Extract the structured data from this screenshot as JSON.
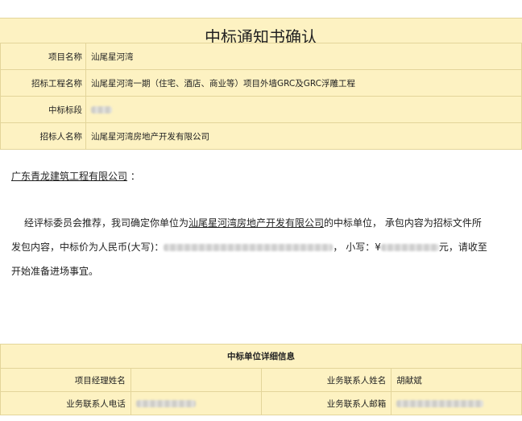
{
  "title": "中标通知书确认",
  "info": {
    "project_name_label": "项目名称",
    "project_name": "汕尾星河湾",
    "tender_project_label": "招标工程名称",
    "tender_project": "汕尾星河湾一期（住宅、酒店、商业等）项目外墙GRC及GRC浮雕工程",
    "winning_section_label": "中标标段",
    "tenderer_label": "招标人名称",
    "tenderer": "汕尾星河湾房地产开发有限公司"
  },
  "letter": {
    "addressee": "广东青龙建筑工程有限公司",
    "addressee_suffix": "：",
    "line1_a": "经评标委员会推荐，我司确定你单位为",
    "line1_company": "汕尾星河湾房地产开发有限公司",
    "line1_b": "的中标单位， 承包内容为招标文件所",
    "line2_a": "发包内容，中标价为人民币(大写)：",
    "line2_b": "， 小写：¥",
    "line2_c": "元，请收至",
    "line3": "开始准备进场事宜。"
  },
  "details": {
    "header": "中标单位详细信息",
    "pm_name_label": "项目经理姓名",
    "contact_name_label": "业务联系人姓名",
    "contact_name": "胡献斌",
    "contact_phone_label": "业务联系人电话",
    "contact_email_label": "业务联系人邮箱"
  }
}
